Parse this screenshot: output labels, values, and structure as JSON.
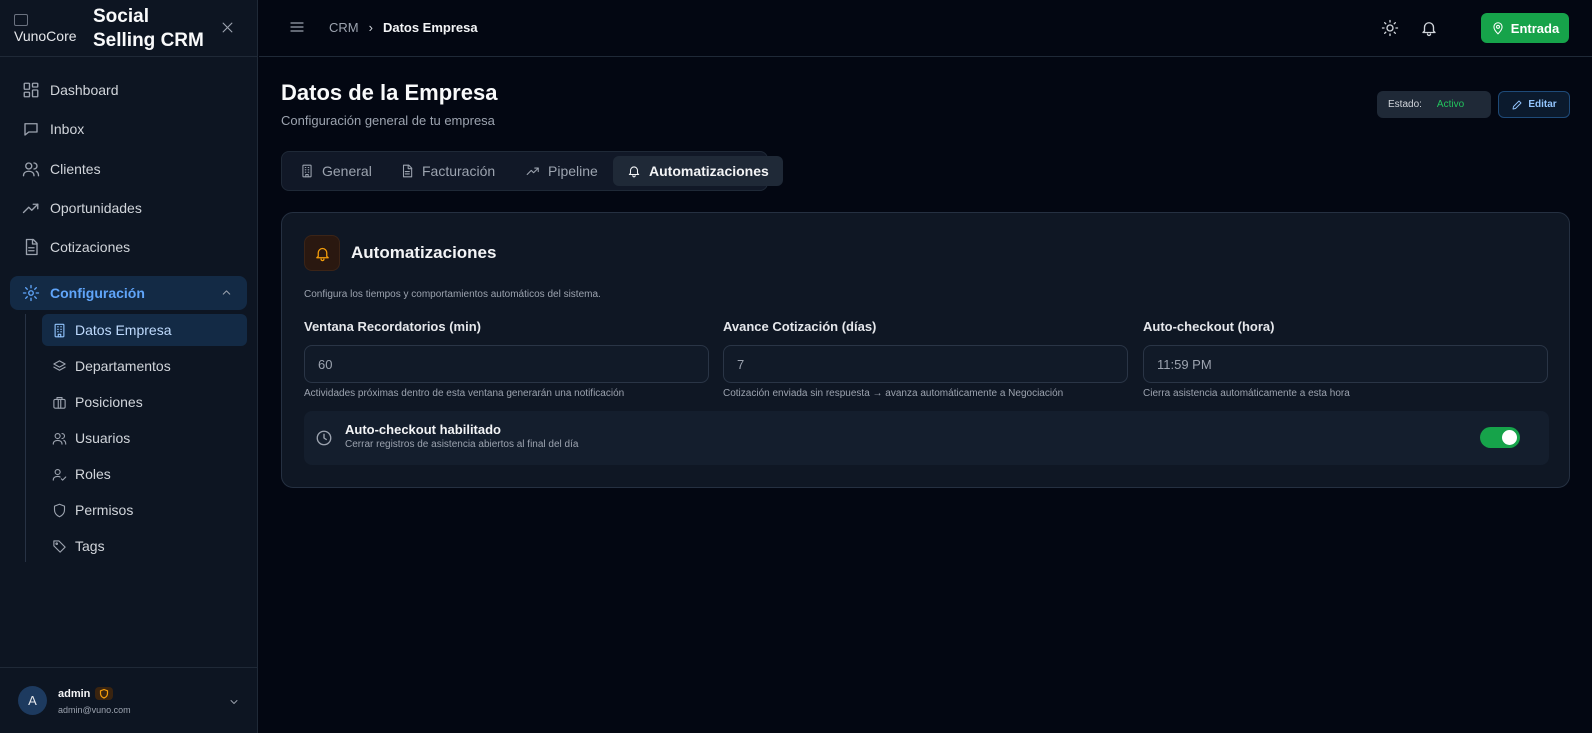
{
  "brand": {
    "logo_alt": "VunoCore",
    "title": "Social Selling CRM"
  },
  "sidebar": {
    "items": [
      {
        "label": "Dashboard",
        "icon": "grid-icon"
      },
      {
        "label": "Inbox",
        "icon": "inbox-icon"
      },
      {
        "label": "Clientes",
        "icon": "users-icon"
      },
      {
        "label": "Oportunidades",
        "icon": "trending-up-icon"
      },
      {
        "label": "Cotizaciones",
        "icon": "file-text-icon"
      }
    ],
    "group": {
      "label": "Configuración",
      "icon": "gear-icon",
      "expanded": true
    },
    "subitems": [
      {
        "label": "Datos Empresa",
        "icon": "building-icon",
        "active": true
      },
      {
        "label": "Departamentos",
        "icon": "layers-icon"
      },
      {
        "label": "Posiciones",
        "icon": "briefcase-icon"
      },
      {
        "label": "Usuarios",
        "icon": "users-icon"
      },
      {
        "label": "Roles",
        "icon": "user-check-icon"
      },
      {
        "label": "Permisos",
        "icon": "shield-icon"
      },
      {
        "label": "Tags",
        "icon": "tag-icon"
      }
    ]
  },
  "user": {
    "initial": "A",
    "name": "admin",
    "email": "admin@vuno.com"
  },
  "header": {
    "breadcrumb": {
      "root": "CRM",
      "separator": "›",
      "current": "Datos Empresa"
    },
    "entrada_label": "Entrada"
  },
  "page": {
    "title": "Datos de la Empresa",
    "subtitle": "Configuración general de tu empresa",
    "status_label": "Estado:",
    "status_value": "Activo",
    "edit_label": "Editar"
  },
  "tabs": [
    {
      "label": "General",
      "icon": "building-icon"
    },
    {
      "label": "Facturación",
      "icon": "file-icon"
    },
    {
      "label": "Pipeline",
      "icon": "trending-up-icon"
    },
    {
      "label": "Automatizaciones",
      "icon": "bell-icon",
      "active": true
    }
  ],
  "card": {
    "title": "Automatizaciones",
    "description": "Configura los tiempos y comportamientos automáticos del sistema.",
    "fields": [
      {
        "label": "Ventana Recordatorios (min)",
        "value": "60",
        "help": "Actividades próximas dentro de esta ventana generarán una notificación"
      },
      {
        "label": "Avance Cotización (días)",
        "value": "7",
        "help": "Cotización enviada sin respuesta → avanza automáticamente a Negociación"
      },
      {
        "label": "Auto-checkout (hora)",
        "value": "11:59 PM",
        "help": "Cierra asistencia automáticamente a esta hora"
      }
    ],
    "toggle": {
      "title": "Auto-checkout habilitado",
      "description": "Cerrar registros de asistencia abiertos al final del día",
      "enabled": true
    }
  },
  "colors": {
    "background": "#030712",
    "sidebar": "#0d1522",
    "accent_blue": "#60a5fa",
    "success_green": "#16a34a",
    "warning_amber": "#f59e0b"
  }
}
